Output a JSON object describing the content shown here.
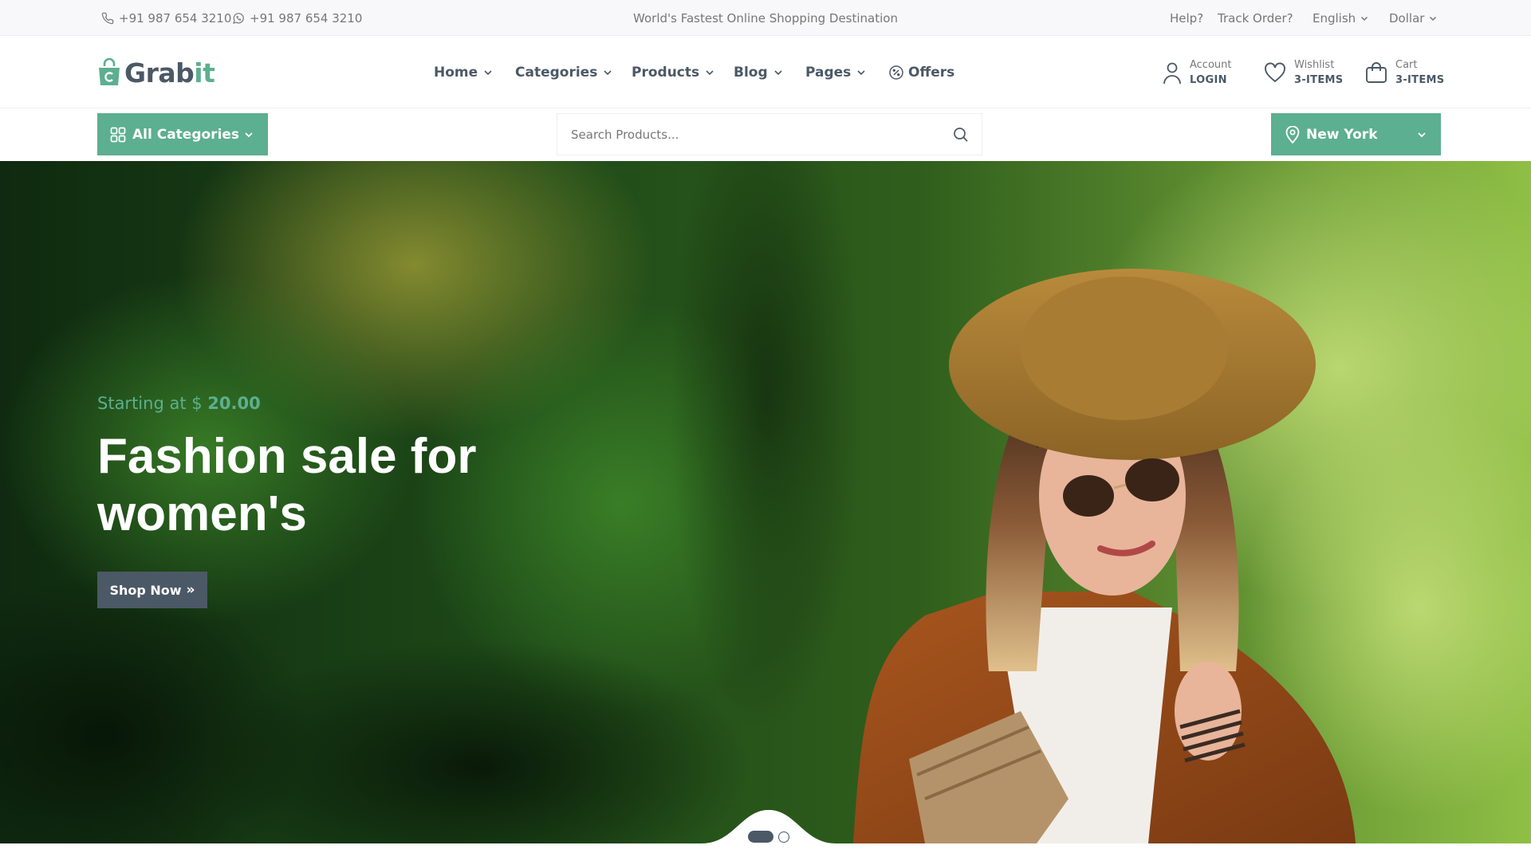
{
  "topbar": {
    "phone": "+91 987 654 3210",
    "whatsapp": "+91 987 654 3210",
    "tagline": "World's Fastest Online Shopping Destination",
    "help": "Help?",
    "track_order": "Track Order?",
    "language": "English",
    "currency": "Dollar"
  },
  "header": {
    "logo_main": "Grab",
    "logo_accent": "it",
    "nav": [
      {
        "label": "Home"
      },
      {
        "label": "Categories"
      },
      {
        "label": "Products"
      },
      {
        "label": "Blog"
      },
      {
        "label": "Pages"
      },
      {
        "label": "Offers"
      }
    ],
    "account": {
      "small": "Account",
      "big": "LOGIN"
    },
    "wishlist": {
      "small": "Wishlist",
      "big": "3-ITEMS"
    },
    "cart": {
      "small": "Cart",
      "big": "3-ITEMS"
    }
  },
  "searchrow": {
    "all_categories": "All Categories",
    "search_placeholder": "Search Products...",
    "location": "New York"
  },
  "hero": {
    "subtitle_prefix": "Starting at $ ",
    "subtitle_price": "20.00",
    "title": "Fashion sale for women's",
    "button": "Shop Now",
    "button_arrow": "»"
  },
  "colors": {
    "accent": "#5caf90",
    "text": "#4b5966",
    "muted": "#777777"
  },
  "icons": [
    "phone-icon",
    "whatsapp-icon",
    "chevron-down-icon",
    "offer-icon",
    "user-icon",
    "heart-icon",
    "bag-icon",
    "grid-icon",
    "search-icon",
    "location-pin-icon"
  ]
}
